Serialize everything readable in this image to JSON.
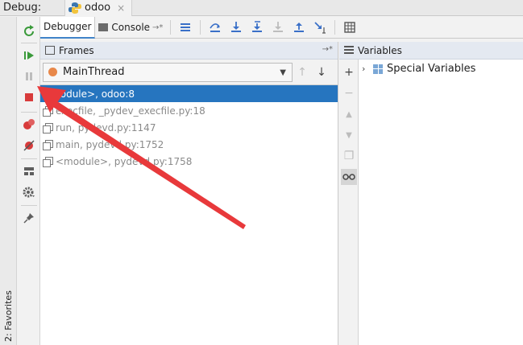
{
  "debug_bar": {
    "label": "Debug:",
    "run_tab": "odoo",
    "close": "×"
  },
  "favorites": {
    "label": "2: Favorites"
  },
  "tabs": [
    {
      "label": "Debugger"
    },
    {
      "label": "Console"
    }
  ],
  "toolbar": {
    "pin": "→*",
    "icons": [
      "show-execution-point-icon",
      "step-over-icon",
      "step-into-icon",
      "step-into-my-code-icon",
      "force-step-into-icon",
      "step-out-icon",
      "run-to-cursor-icon",
      "evaluate-expression-icon"
    ]
  },
  "frames": {
    "title": "Frames",
    "thread": "MainThread",
    "rows": [
      {
        "text": "<module>, odoo:8"
      },
      {
        "text": "execfile, _pydev_execfile.py:18"
      },
      {
        "text": "run, pydevd.py:1147"
      },
      {
        "text": "main, pydevd.py:1752"
      },
      {
        "text": "<module>, pydevd.py:1758"
      }
    ]
  },
  "variables": {
    "title": "Variables",
    "special": "Special Variables"
  },
  "colors": {
    "selection": "#2675bf",
    "header": "#e4e9f1",
    "thread_dot": "#e8884a",
    "annotation_arrow": "#e8393b"
  }
}
